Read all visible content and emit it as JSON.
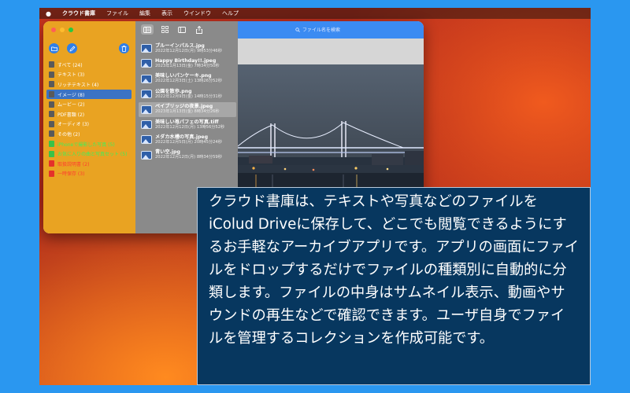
{
  "menubar": {
    "apple": "",
    "app": "クラウド書庫",
    "items": [
      "ファイル",
      "編集",
      "表示",
      "ウインドウ",
      "ヘルプ"
    ]
  },
  "toolbar": {
    "search_placeholder": "ファイル名を検索"
  },
  "sidebar": {
    "items": [
      {
        "label": "すべて (24)",
        "icon": "all-files-icon",
        "style": "normal"
      },
      {
        "label": "テキスト (3)",
        "icon": "text-file-icon",
        "style": "normal"
      },
      {
        "label": "リッチテキスト (4)",
        "icon": "rich-text-icon",
        "style": "normal"
      },
      {
        "label": "イメージ (8)",
        "icon": "image-icon",
        "style": "selected"
      },
      {
        "label": "ムービー (2)",
        "icon": "movie-icon",
        "style": "normal"
      },
      {
        "label": "PDF書類 (2)",
        "icon": "pdf-icon",
        "style": "normal"
      },
      {
        "label": "オーディオ (3)",
        "icon": "audio-icon",
        "style": "normal"
      },
      {
        "label": "その他 (2)",
        "icon": "other-icon",
        "style": "normal"
      },
      {
        "label": "iPhoneで撮影した写真 (5)",
        "icon": "collection-icon",
        "style": "green"
      },
      {
        "label": "お気に入りの曲と写真セット (5)",
        "icon": "collection-icon",
        "style": "green"
      },
      {
        "label": "取扱説明書 (2)",
        "icon": "collection-icon",
        "style": "red"
      },
      {
        "label": "一時保存 (3)",
        "icon": "trash-icon",
        "style": "red"
      }
    ]
  },
  "files": [
    {
      "name": "ブルーインパルス.jpg",
      "date": "2022年12月12日(月) 9時53分46秒"
    },
    {
      "name": "Happy Birthday!!.jpeg",
      "date": "2023年1月13日(金) 7時34分50秒"
    },
    {
      "name": "美味しいパンケーキ.png",
      "date": "2022年12月3日(土) 13時26分52秒"
    },
    {
      "name": "公園を散歩.png",
      "date": "2022年12月9日(金) 14時15分31秒"
    },
    {
      "name": "ベイブリッジの夜景.jpeg",
      "date": "2023年1月13日(金) 8時34分26秒"
    },
    {
      "name": "美味しい苺パフェの写真.tiff",
      "date": "2022年12月12日(月) 13時56分52秒"
    },
    {
      "name": "メダカ水槽の写真.jpeg",
      "date": "2022年12月5日(月) 20時45分24秒"
    },
    {
      "name": "青い空.jpg",
      "date": "2022年12月12日(月) 8時34分59秒"
    }
  ],
  "selected_file_index": 4,
  "overlay": {
    "text": "クラウド書庫は、テキストや写真などのファイルをiColud Driveに保存して、どこでも閲覧できるようにするお手軽なアーカイブアプリです。アプリの画面にファイルをドロップするだけでファイルの種類別に自動的に分類します。ファイルの中身はサムネイル表示、動画やサウンドの再生などで確認できます。ユーザ自身でファイルを管理するコレクションを作成可能です。"
  },
  "colors": {
    "sidebar": "#e9a322",
    "toolbar": "#3b8bf2",
    "selection": "#3b73c4",
    "overlay_bg": "#07375f",
    "collection_green": "#3ef05a",
    "collection_red": "#ff3b30"
  }
}
